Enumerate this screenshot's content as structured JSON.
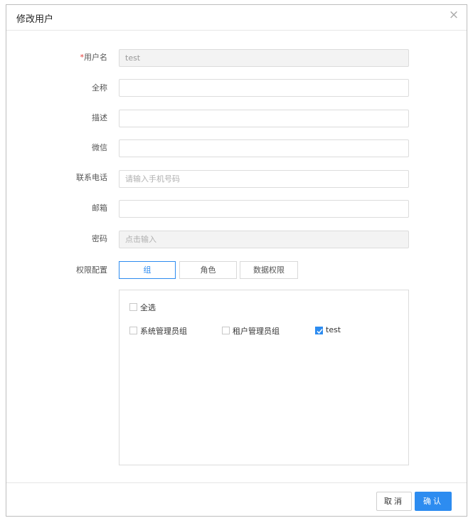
{
  "dialog": {
    "title": "修改用户",
    "close_symbol": "×"
  },
  "form": {
    "username": {
      "required_mark": "*",
      "label": "用户名",
      "value": "test"
    },
    "fullname": {
      "label": "全称",
      "value": ""
    },
    "description": {
      "label": "描述",
      "value": ""
    },
    "wechat": {
      "label": "微信",
      "value": ""
    },
    "phone": {
      "label": "联系电话",
      "value": "",
      "placeholder": "请输入手机号码"
    },
    "email": {
      "label": "邮箱",
      "value": ""
    },
    "password": {
      "label": "密码",
      "value": "",
      "placeholder": "点击输入"
    },
    "permission": {
      "label": "权限配置",
      "tabs": [
        {
          "label": "组",
          "active": true
        },
        {
          "label": "角色",
          "active": false
        },
        {
          "label": "数据权限",
          "active": false
        }
      ],
      "select_all": {
        "label": "全选",
        "checked": false
      },
      "groups": [
        {
          "label": "系统管理员组",
          "checked": false
        },
        {
          "label": "租户管理员组",
          "checked": false
        },
        {
          "label": "test",
          "checked": true
        }
      ]
    }
  },
  "footer": {
    "cancel_label": "取消",
    "confirm_label": "确认"
  },
  "colors": {
    "accent": "#2d8cf0",
    "required": "#e53935"
  }
}
